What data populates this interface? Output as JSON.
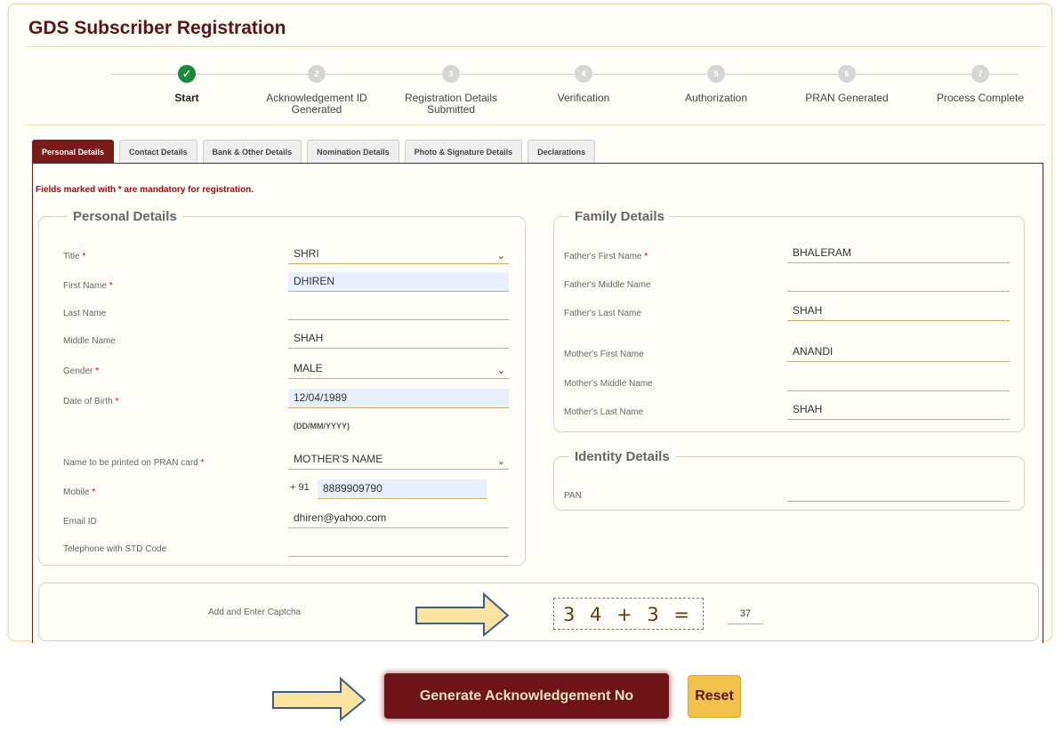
{
  "page": {
    "title": "GDS Subscriber Registration"
  },
  "stepper": [
    {
      "num": "✓",
      "label": "Start",
      "done": true
    },
    {
      "num": "2",
      "label": "Acknowledgement ID Generated",
      "done": false
    },
    {
      "num": "3",
      "label": "Registration Details Submitted",
      "done": false
    },
    {
      "num": "4",
      "label": "Verification",
      "done": false
    },
    {
      "num": "5",
      "label": "Authorization",
      "done": false
    },
    {
      "num": "6",
      "label": "PRAN Generated",
      "done": false
    },
    {
      "num": "7",
      "label": "Process Complete",
      "done": false
    }
  ],
  "tabs": [
    "Personal Details",
    "Contact Details",
    "Bank & Other Details",
    "Nomination Details",
    "Photo & Signature Details",
    "Declarations"
  ],
  "notice": "Fields marked with * are mandatory for registration.",
  "personal": {
    "legend": "Personal Details",
    "title_label": "Title",
    "title_value": "SHRI",
    "first_label": "First Name",
    "first_value": "DHIREN",
    "last_label": "Last Name",
    "last_value": "",
    "middle_label": "Middle Name",
    "middle_value": "SHAH",
    "gender_label": "Gender",
    "gender_value": "MALE",
    "dob_label": "Date of Birth",
    "dob_value": "12/04/1989",
    "dob_hint": "(DD/MM/YYYY)",
    "pran_label": "Name to be printed on PRAN card",
    "pran_value": "MOTHER'S NAME",
    "mobile_label": "Mobile",
    "mobile_prefix": "+ 91",
    "mobile_value": "8889909790",
    "email_label": "Email ID",
    "email_value": "dhiren@yahoo.com",
    "tel_label": "Telephone with STD Code",
    "tel_value": ""
  },
  "family": {
    "legend": "Family Details",
    "father_first_label": "Father's First Name",
    "father_first_value": "BHALERAM",
    "father_middle_label": "Father's Middle Name",
    "father_middle_value": "",
    "father_last_label": "Father's Last Name",
    "father_last_value": "SHAH",
    "mother_first_label": "Mother's First Name",
    "mother_first_value": "ANANDI",
    "mother_middle_label": "Mother's Middle Name",
    "mother_middle_value": "",
    "mother_last_label": "Mother's Last Name",
    "mother_last_value": "SHAH"
  },
  "identity": {
    "legend": "Identity Details",
    "pan_label": "PAN",
    "pan_value": ""
  },
  "captcha": {
    "label": "Add and Enter Captcha",
    "expression": "3 4 + 3 =",
    "answer": "37"
  },
  "buttons": {
    "generate": "Generate Acknowledgement No",
    "reset": "Reset"
  },
  "colors": {
    "brand": "#7a1b1b",
    "accent": "#f2c14a",
    "success": "#1b8a3d"
  }
}
